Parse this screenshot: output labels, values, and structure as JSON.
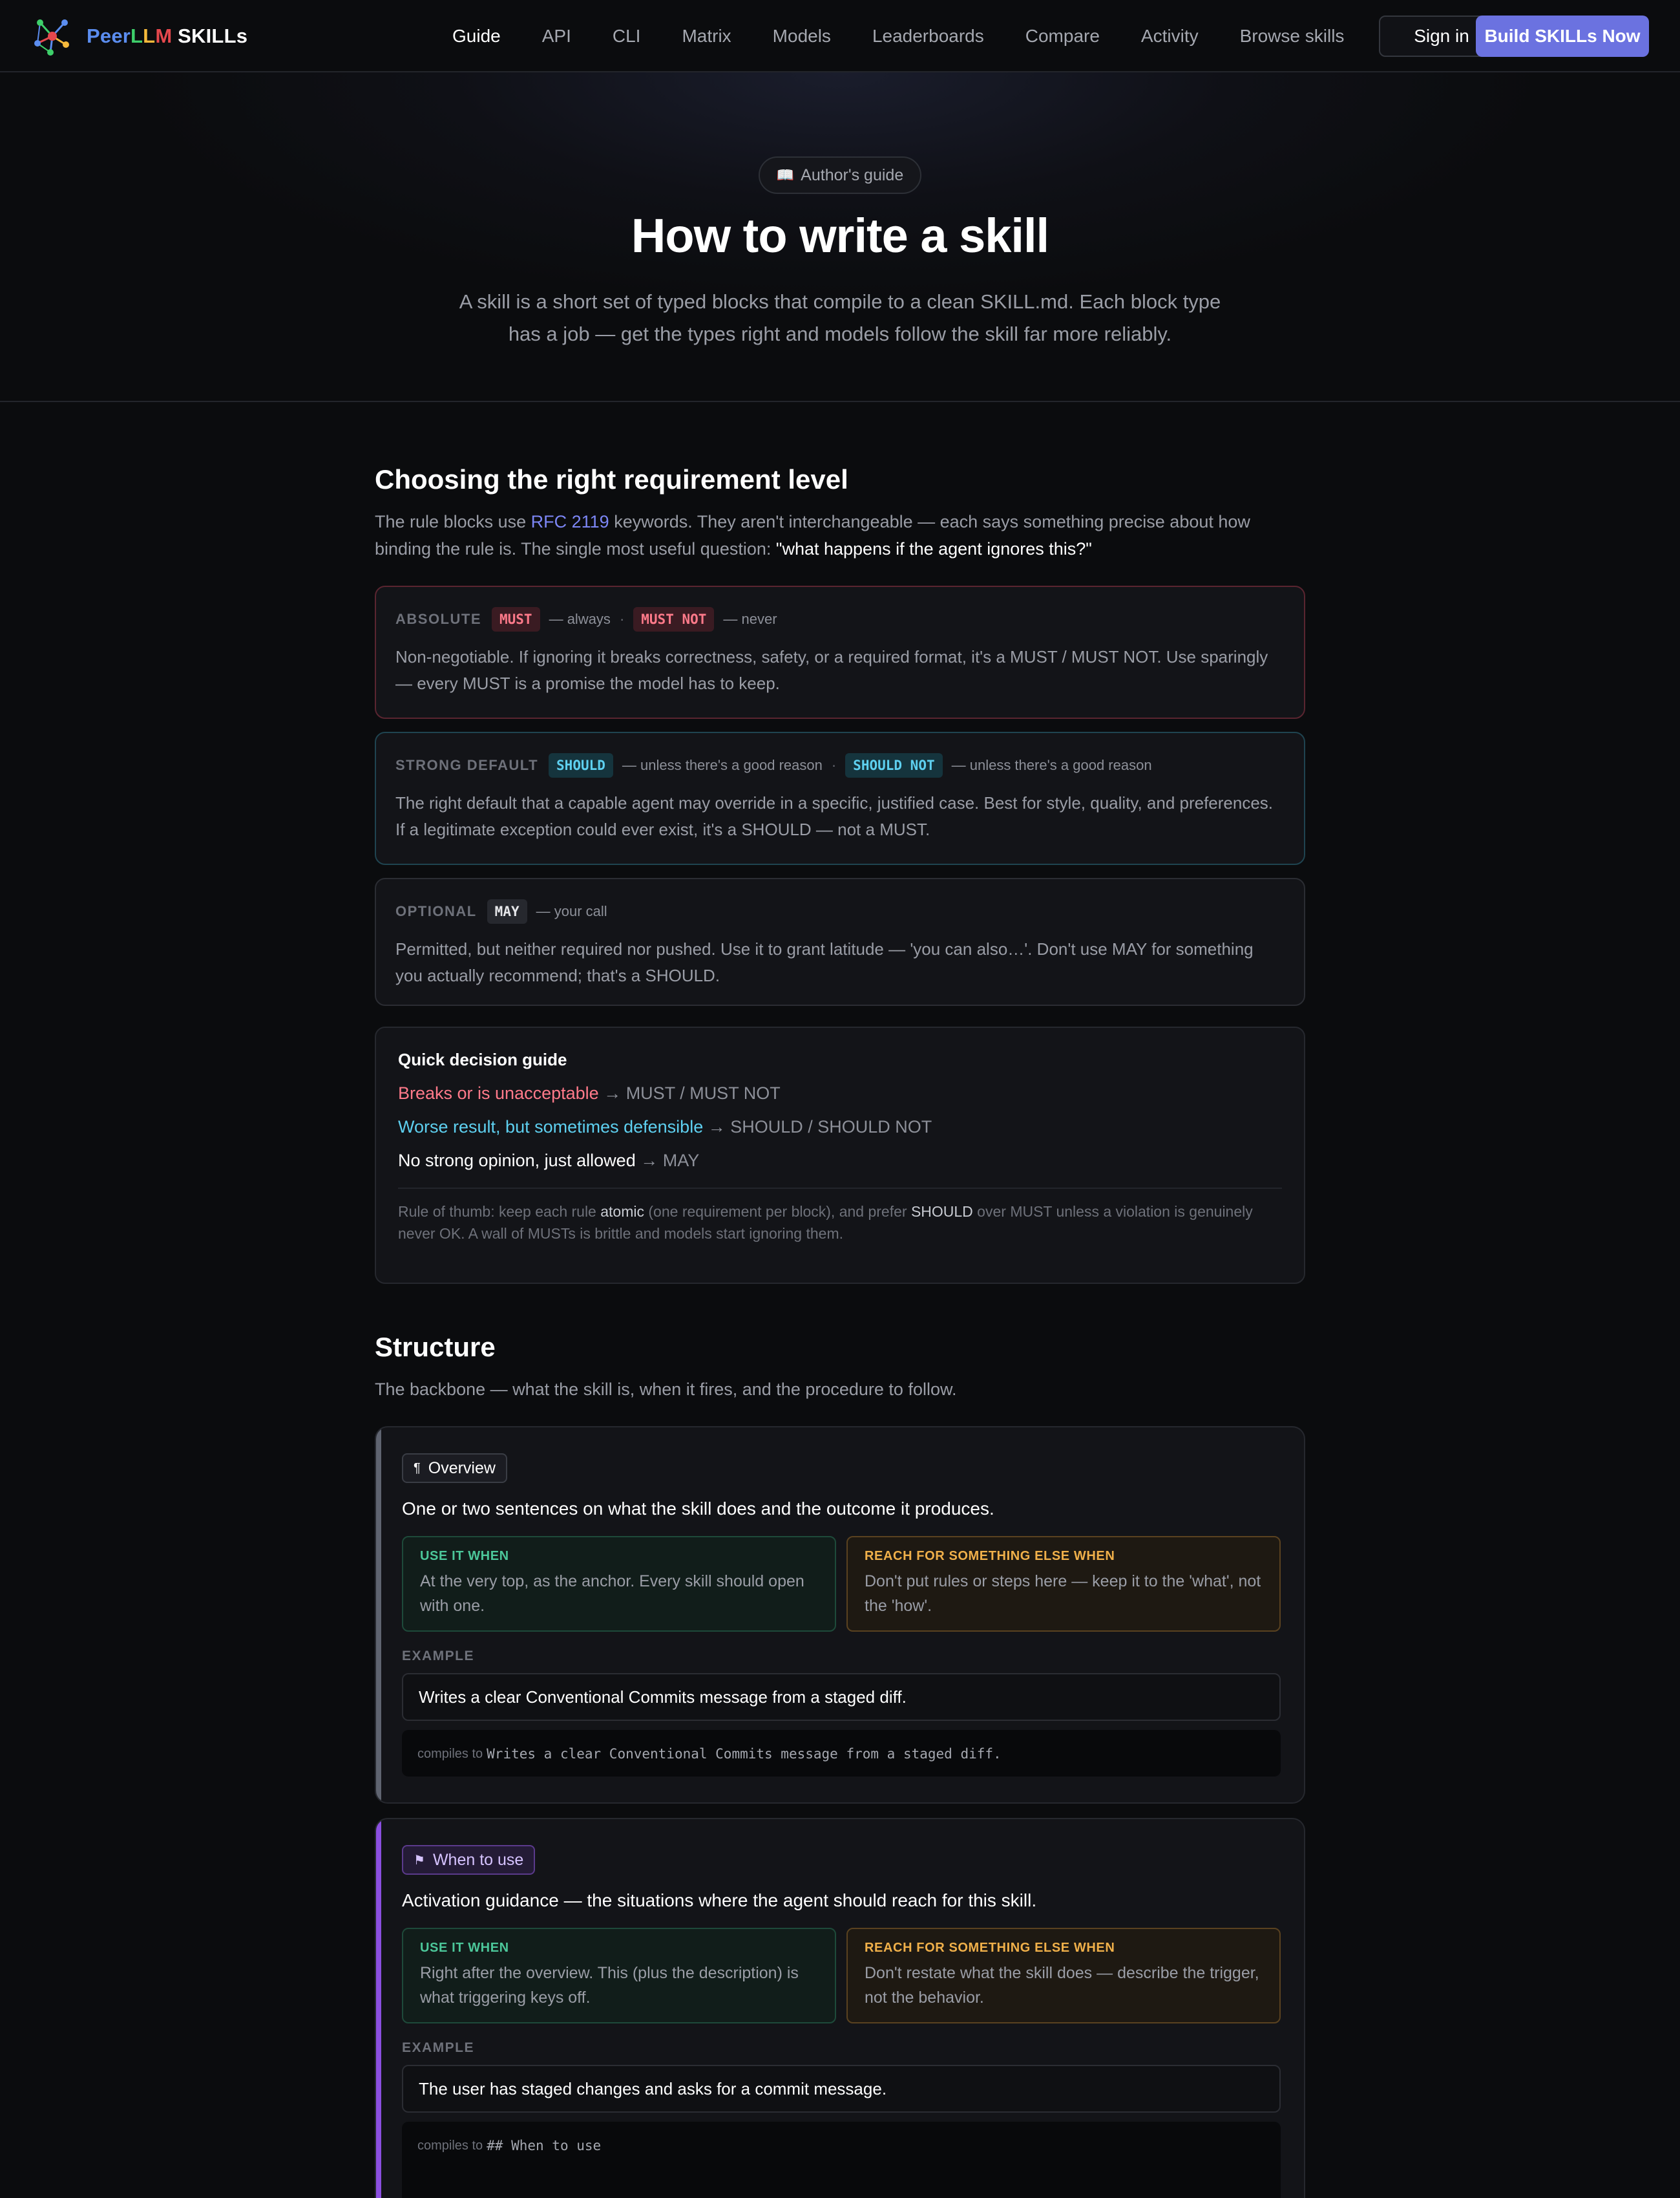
{
  "nav": {
    "brand": {
      "peer": "Peer",
      "l1": "L",
      "l2": "L",
      "m": "M",
      "skills": " SKILLs"
    },
    "links": [
      "Guide",
      "API",
      "CLI",
      "Matrix",
      "Models",
      "Leaderboards",
      "Compare",
      "Activity",
      "Browse skills"
    ],
    "active": "Guide",
    "signin": "Sign in",
    "build": "Build SKILLs Now"
  },
  "hero": {
    "pill": "Author's guide",
    "title": "How to write a skill",
    "subtitle": "A skill is a short set of typed blocks that compile to a clean SKILL.md. Each block type has a job — get the types right and models follow the skill far more reliably."
  },
  "requirements": {
    "heading": "Choosing the right requirement level",
    "intro_pre": "The rule blocks use ",
    "intro_link": "RFC 2119",
    "intro_mid": " keywords. They aren't interchangeable — each says something precise about how binding the rule is. The single most useful question: ",
    "intro_q": "\"what happens if the agent ignores this?\"",
    "absolute": {
      "label": "ABSOLUTE",
      "kw1": "MUST",
      "d1": "— always",
      "kw2": "MUST NOT",
      "d2": "— never",
      "body": "Non-negotiable. If ignoring it breaks correctness, safety, or a required format, it's a MUST / MUST NOT. Use sparingly — every MUST is a promise the model has to keep."
    },
    "strong": {
      "label": "STRONG DEFAULT",
      "kw1": "SHOULD",
      "d1": "— unless there's a good reason",
      "kw2": "SHOULD NOT",
      "d2": "— unless there's a good reason",
      "body": "The right default that a capable agent may override in a specific, justified case. Best for style, quality, and preferences. If a legitimate exception could ever exist, it's a SHOULD — not a MUST."
    },
    "optional": {
      "label": "OPTIONAL",
      "kw1": "MAY",
      "d1": "— your call",
      "body": "Permitted, but neither required nor pushed. Use it to grant latitude — 'you can also…'. Don't use MAY for something you actually recommend; that's a SHOULD."
    },
    "guide": {
      "title": "Quick decision guide",
      "r1a": "Breaks or is unacceptable",
      "r1b": "→ MUST / MUST NOT",
      "r2a": "Worse result, but sometimes defensible",
      "r2b": "→ SHOULD / SHOULD NOT",
      "r3a": "No strong opinion, just allowed",
      "r3b": "→ MAY",
      "foot1": "Rule of thumb: keep each rule ",
      "foot_atomic": "atomic",
      "foot2": " (one requirement per block), and prefer ",
      "foot_should": "SHOULD",
      "foot3": " over MUST unless a violation is genuinely never OK. A wall of MUSTs is brittle and models start ignoring them."
    }
  },
  "structure": {
    "heading": "Structure",
    "intro": "The backbone — what the skill is, when it fires, and the procedure to follow.",
    "use_label": "USE IT WHEN",
    "else_label": "REACH FOR SOMETHING ELSE WHEN",
    "example_label": "EXAMPLE",
    "compiles_label": "compiles to",
    "blocks": [
      {
        "tag": "Overview",
        "lead": "One or two sentences on what the skill does and the outcome it produces.",
        "use": "At the very top, as the anchor. Every skill should open with one.",
        "else": "Don't put rules or steps here — keep it to the 'what', not the 'how'.",
        "example": "Writes a clear Conventional Commits message from a staged diff.",
        "compiled": "Writes a clear Conventional Commits message from a staged diff."
      },
      {
        "tag": "When to use",
        "lead": "Activation guidance — the situations where the agent should reach for this skill.",
        "use": "Right after the overview. This (plus the description) is what triggering keys off.",
        "else": "Don't restate what the skill does — describe the trigger, not the behavior.",
        "example": "The user has staged changes and asks for a commit message.",
        "compiled": "## When to use"
      }
    ]
  },
  "colors": {
    "accent": "#6b72e0",
    "overview_accent": "#5f6470",
    "when_accent": "#8b4fe0",
    "must": "#ff7a8a",
    "should": "#5ed0f0"
  }
}
